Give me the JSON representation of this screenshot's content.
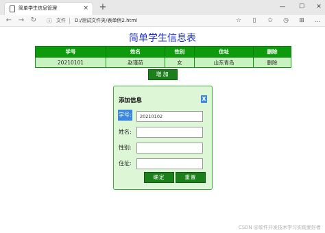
{
  "browser": {
    "tab_title": "简单学生信息管理",
    "tab_close": "×",
    "new_tab": "+",
    "window_controls": {
      "minimize": "—",
      "maximize": "☐",
      "close": "✕"
    },
    "url_info_icon": "ⓘ",
    "url_file_label": "文件",
    "url": "D:/测试文件夹/表单例2.html"
  },
  "page": {
    "title": "简单学生信息表",
    "table": {
      "headers": [
        "学号",
        "姓名",
        "性别",
        "住址",
        "删除"
      ],
      "rows": [
        [
          "20210101",
          "赵瑾茹",
          "女",
          "山东青岛",
          "删除"
        ]
      ]
    },
    "add_button": "增加"
  },
  "dialog": {
    "title": "添加信息",
    "close_label": "X",
    "fields": [
      {
        "label": "学号:",
        "value": "20210102"
      },
      {
        "label": "姓名:",
        "value": ""
      },
      {
        "label": "性别:",
        "value": ""
      },
      {
        "label": "住址:",
        "value": ""
      }
    ],
    "confirm": "确定",
    "reset": "重置"
  },
  "watermark": "CSDN @软件开发技术学习实践爱好者"
}
